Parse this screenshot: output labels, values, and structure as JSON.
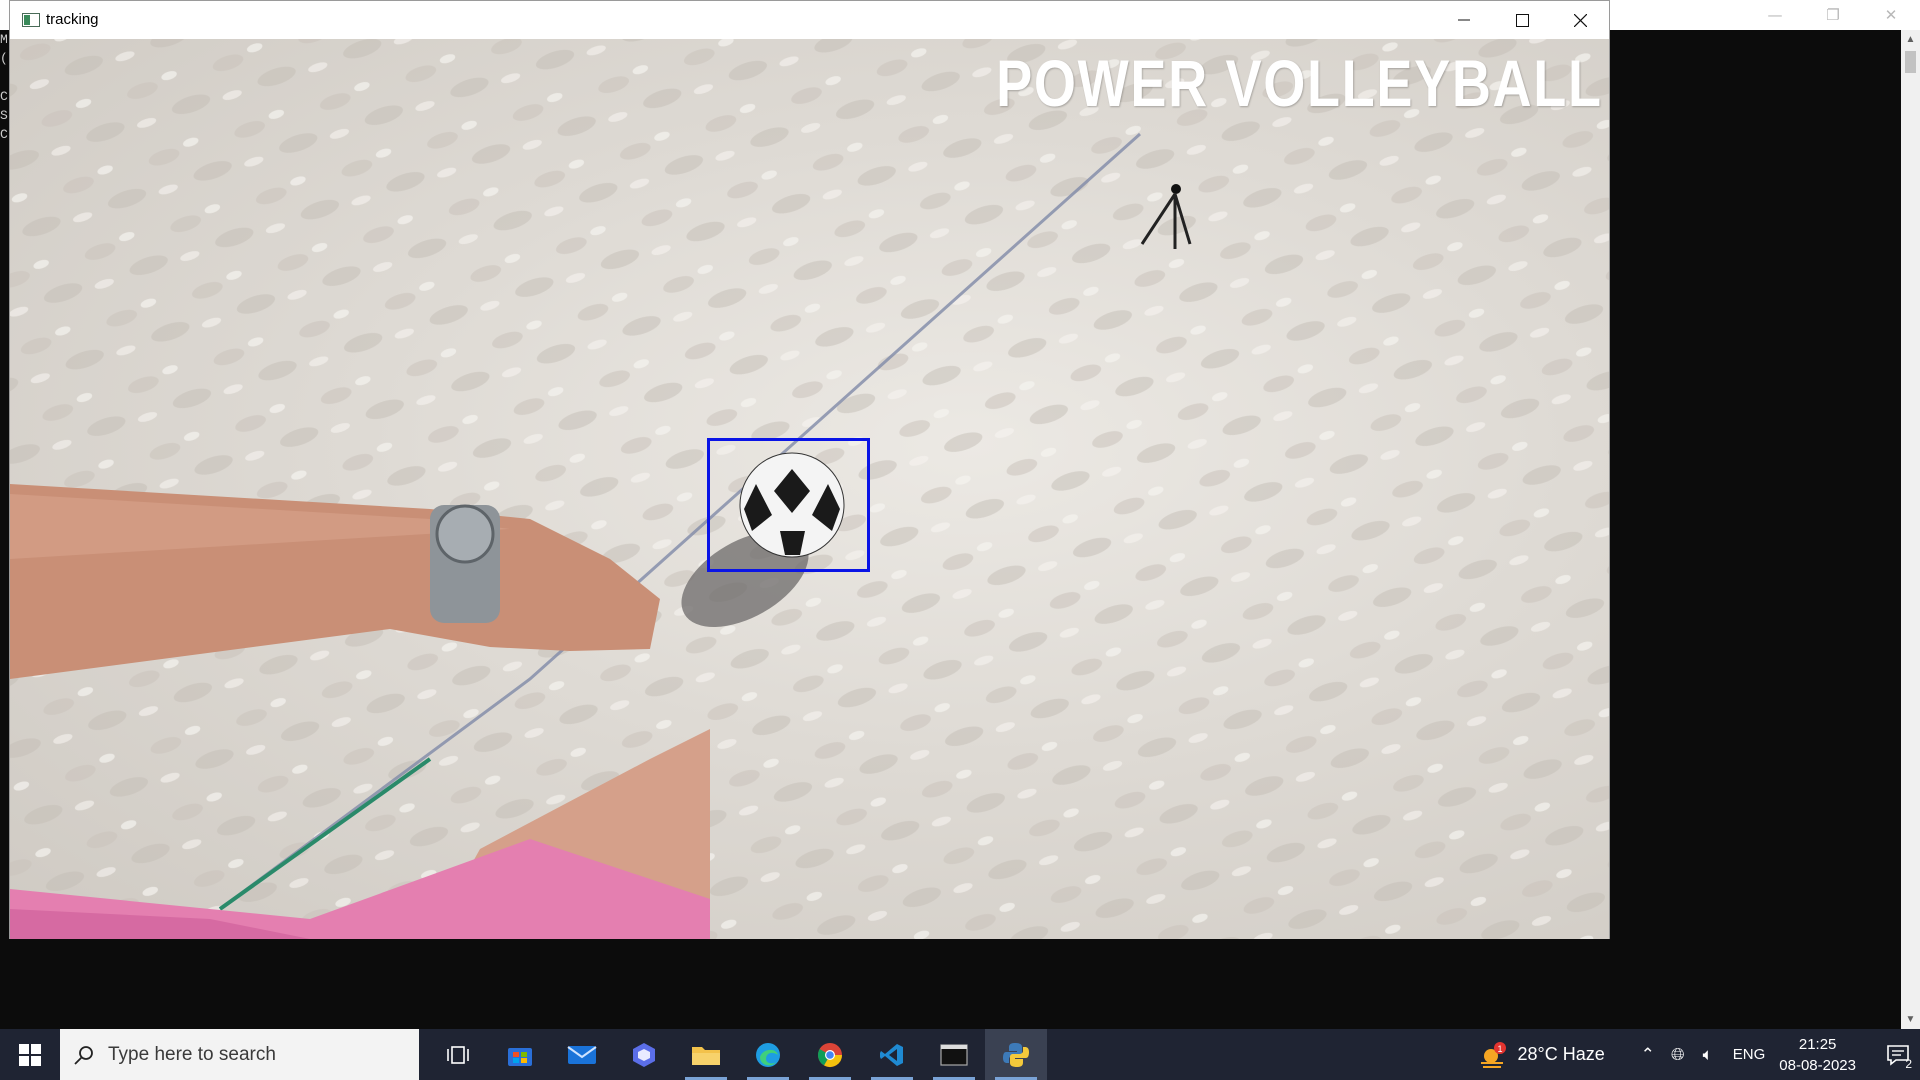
{
  "console": {
    "text_lines": [
      "M",
      "(",
      "",
      "C",
      "S",
      "C"
    ],
    "controls": {
      "minimize": "—",
      "restore": "❐",
      "close": "✕"
    }
  },
  "window": {
    "title": "tracking",
    "controls": {
      "minimize": "—",
      "maximize": "☐",
      "close": "✕"
    }
  },
  "video": {
    "watermark": "POWER VOLLEYBALL",
    "tracking_box_color": "#0a14e6"
  },
  "taskbar": {
    "search_placeholder": "Type here to search",
    "apps": [
      {
        "name": "task-view"
      },
      {
        "name": "microsoft-store"
      },
      {
        "name": "mail"
      },
      {
        "name": "copilot"
      },
      {
        "name": "file-explorer"
      },
      {
        "name": "edge"
      },
      {
        "name": "chrome"
      },
      {
        "name": "vscode"
      },
      {
        "name": "terminal"
      },
      {
        "name": "python"
      }
    ],
    "weather": {
      "temp": "28°C Haze",
      "badge": "1"
    },
    "language": "ENG",
    "time": "21:25",
    "date": "08-08-2023",
    "notification_count": "2"
  }
}
